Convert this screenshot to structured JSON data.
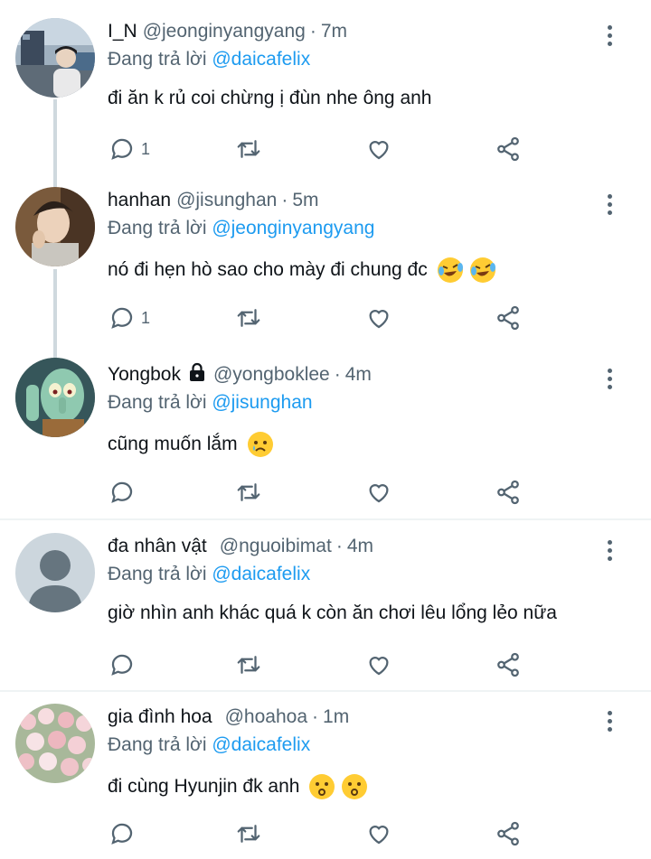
{
  "reply_prefix": "Đang trả lời",
  "tweets": [
    {
      "name": "I_N",
      "handle": "@jeonginyangyang",
      "time": "7m",
      "reply_to": "@daicafelix",
      "text": "đi ăn k rủ coi chừng ị đùn nhe ông anh",
      "reply_count": "1",
      "avatar": "photo-man-outdoor"
    },
    {
      "name": "hanhan",
      "handle": "@jisunghan",
      "time": "5m",
      "reply_to": "@jeonginyangyang",
      "text": "nó đi hẹn hò sao cho mày đi chung đc",
      "emoji": [
        "rofl-emoji",
        "rofl-emoji"
      ],
      "reply_count": "1",
      "avatar": "photo-young-man"
    },
    {
      "name": "Yongbok",
      "handle": "@yongboklee",
      "time": "4m",
      "reply_to": "@jisunghan",
      "text": "cũng muốn lắm",
      "emoji": [
        "sad-tear-emoji"
      ],
      "reply_count": "",
      "avatar": "cartoon-squid"
    },
    {
      "name": "đa nhân vật",
      "handle": "@nguoibimat",
      "time": "4m",
      "reply_to": "@daicafelix",
      "text": "giờ nhìn anh khác quá k còn ăn chơi lêu lổng lẻo nữa",
      "reply_count": "",
      "avatar": "default-avatar"
    },
    {
      "name": "gia đình hoa",
      "handle": "@hoahoa",
      "time": "1m",
      "reply_to": "@daicafelix",
      "text": "đi cùng Hyunjin đk anh",
      "emoji": [
        "kissing-emoji",
        "kissing-emoji"
      ],
      "reply_count": "",
      "avatar": "photo-tulips"
    }
  ],
  "colors": {
    "text": "#0f1419",
    "secondary": "#536471",
    "link": "#1d9bf0",
    "divider": "#eff3f4",
    "thread_line": "#cfd9de"
  }
}
